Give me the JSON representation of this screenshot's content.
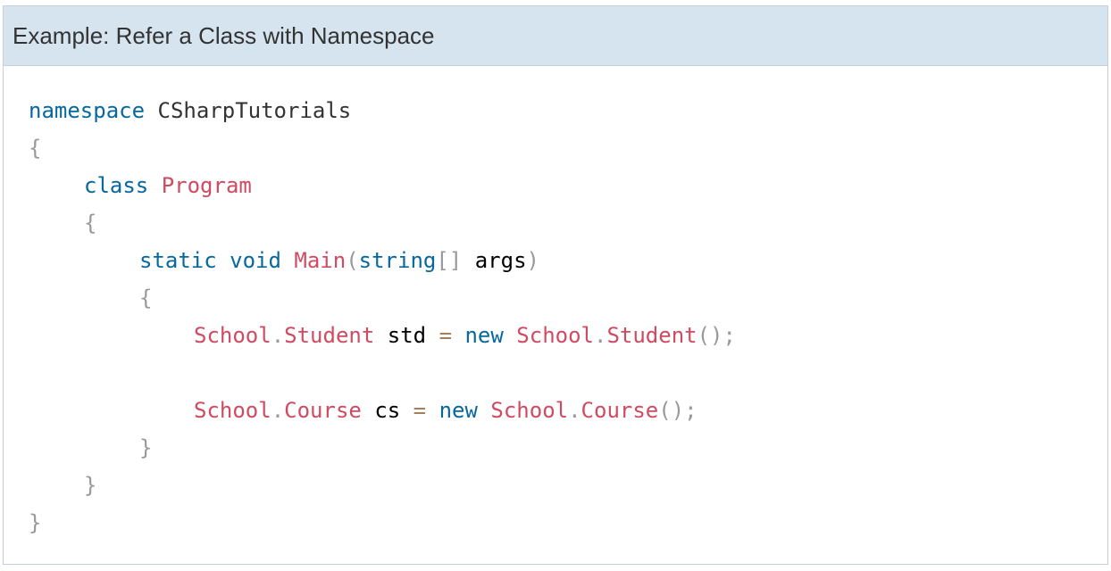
{
  "example": {
    "title": "Example: Refer a Class with Namespace"
  },
  "code": {
    "l1": {
      "kw": "namespace",
      "name": "CSharpTutorials"
    },
    "l2": {
      "brace": "{"
    },
    "l3": {
      "kw": "class",
      "name": "Program"
    },
    "l4": {
      "brace": "{"
    },
    "l5": {
      "kw1": "static",
      "kw2": "void",
      "method": "Main",
      "open": "(",
      "kw3": "string",
      "arr": "[]",
      "param": "args",
      "close": ")"
    },
    "l6": {
      "brace": "{"
    },
    "l7": {
      "ns": "School",
      "dot": ".",
      "cls": "Student",
      "var": "std",
      "eq": "=",
      "kw": "new",
      "ns2": "School",
      "dot2": ".",
      "cls2": "Student",
      "call": "();"
    },
    "l9": {
      "ns": "School",
      "dot": ".",
      "cls": "Course",
      "var": "cs",
      "eq": "=",
      "kw": "new",
      "ns2": "School",
      "dot2": ".",
      "cls2": "Course",
      "call": "();"
    },
    "l10": {
      "brace": "}"
    },
    "l11": {
      "brace": "}"
    },
    "l12": {
      "brace": "}"
    }
  }
}
